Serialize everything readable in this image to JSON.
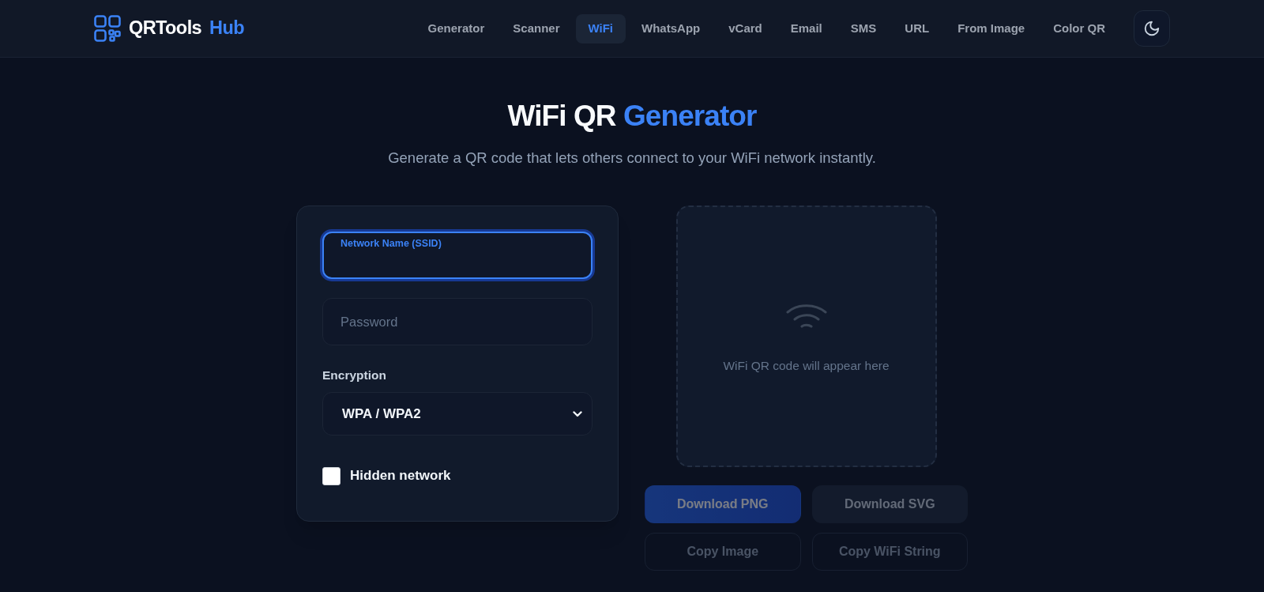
{
  "header": {
    "logo": {
      "text": "QRTools",
      "highlight": "Hub"
    },
    "nav": [
      {
        "label": "Generator",
        "selected": false
      },
      {
        "label": "Scanner",
        "selected": false
      },
      {
        "label": "WiFi",
        "selected": true
      },
      {
        "label": "WhatsApp",
        "selected": false
      },
      {
        "label": "vCard",
        "selected": false
      },
      {
        "label": "Email",
        "selected": false
      },
      {
        "label": "SMS",
        "selected": false
      },
      {
        "label": "URL",
        "selected": false
      },
      {
        "label": "From Image",
        "selected": false
      },
      {
        "label": "Color QR",
        "selected": false
      }
    ]
  },
  "hero": {
    "title": "WiFi QR",
    "title_highlight": "Generator",
    "subtitle": "Generate a QR code that lets others connect to your WiFi network instantly."
  },
  "form": {
    "fields": [
      {
        "label": "Network Name (SSID)",
        "focused": true
      },
      {
        "placeholder": "Password",
        "focused": false
      }
    ],
    "encryption": {
      "label": "Encryption",
      "value": "WPA / WPA2"
    },
    "hidden_network": {
      "label": "Hidden network",
      "checked": false
    }
  },
  "preview": {
    "message": "WiFi QR code will appear here"
  },
  "actions": [
    {
      "label": "Download PNG",
      "kind": "primary",
      "disabled": true
    },
    {
      "label": "Download SVG",
      "kind": "secondary",
      "disabled": true
    },
    {
      "label": "Copy Image",
      "kind": "outline",
      "disabled": true
    },
    {
      "label": "Copy WiFi String",
      "kind": "outline",
      "disabled": true
    }
  ]
}
